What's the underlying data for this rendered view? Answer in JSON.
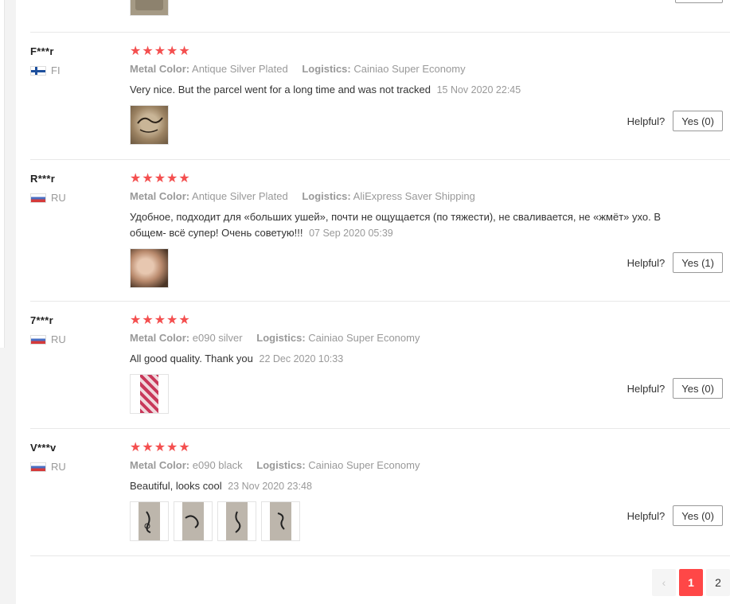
{
  "helpful_label": "Helpful?",
  "colors": {
    "star": "#f44f4f",
    "accent": "#ff4747"
  },
  "top_stub": {
    "thumb_icon": "product-photo"
  },
  "reviews": [
    {
      "user": "F***r",
      "country_code": "FI",
      "flag_icon": "finland-flag-icon",
      "stars": "★★★★★",
      "rating": 5,
      "color_label": "Metal Color:",
      "color_value": "Antique Silver Plated",
      "logistics_label": "Logistics:",
      "logistics_value": "Cainiao Super Economy",
      "text": "Very nice. But the parcel went for a long time and was not tracked",
      "date": "15 Nov 2020 22:45",
      "helpful_button": "Yes (0)"
    },
    {
      "user": "R***r",
      "country_code": "RU",
      "flag_icon": "russia-flag-icon",
      "stars": "★★★★★",
      "rating": 5,
      "color_label": "Metal Color:",
      "color_value": "Antique Silver Plated",
      "logistics_label": "Logistics:",
      "logistics_value": "AliExpress Saver Shipping",
      "text": "Удобное, подходит для «больших ушей», почти не ощущается (по тяжести), не сваливается, не «жмёт» ухо. В общем- всё супер! Очень советую!!!",
      "date": "07 Sep 2020 05:39",
      "helpful_button": "Yes (1)"
    },
    {
      "user": "7***r",
      "country_code": "RU",
      "flag_icon": "russia-flag-icon",
      "stars": "★★★★★",
      "rating": 5,
      "color_label": "Metal Color:",
      "color_value": "e090 silver",
      "logistics_label": "Logistics:",
      "logistics_value": "Cainiao Super Economy",
      "text": "All good quality. Thank you",
      "date": "22 Dec 2020 10:33",
      "helpful_button": "Yes (0)"
    },
    {
      "user": "V***v",
      "country_code": "RU",
      "flag_icon": "russia-flag-icon",
      "stars": "★★★★★",
      "rating": 5,
      "color_label": "Metal Color:",
      "color_value": "e090 black",
      "logistics_label": "Logistics:",
      "logistics_value": "Cainiao Super Economy",
      "text": "Beautiful, looks cool",
      "date": "23 Nov 2020 23:48",
      "helpful_button": "Yes (0)"
    }
  ],
  "pagination": {
    "prev": "‹",
    "pages": [
      "1",
      "2"
    ],
    "current": "1"
  }
}
